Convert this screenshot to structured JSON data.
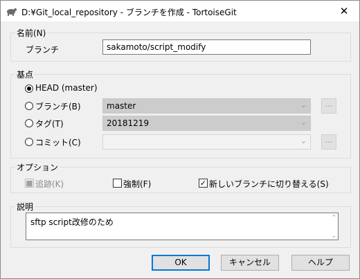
{
  "window": {
    "title": "D:¥Git_local_repository - ブランチを作成 - TortoiseGit",
    "close": "✕"
  },
  "name_group": {
    "legend": "名前(N)",
    "branch_label": "ブランチ",
    "branch_value": "sakamoto/script_modify"
  },
  "base_group": {
    "legend": "基点",
    "head_option": "HEAD (master)",
    "branch_option": "ブランチ(B)",
    "branch_combo": "master",
    "tag_option": "タグ(T)",
    "tag_combo": "20181219",
    "commit_option": "コミット(C)",
    "commit_combo": "",
    "browse": "..."
  },
  "options_group": {
    "legend": "オプション",
    "track": "追跡(K)",
    "force": "強制(F)",
    "switch": "新しいブランチに切り替える(S)",
    "track_checked": true,
    "force_checked": false,
    "switch_checked": true
  },
  "desc_group": {
    "legend": "説明",
    "text": "sftp script改修のため"
  },
  "buttons": {
    "ok": "OK",
    "cancel": "キャンセル",
    "help": "ヘルプ"
  }
}
